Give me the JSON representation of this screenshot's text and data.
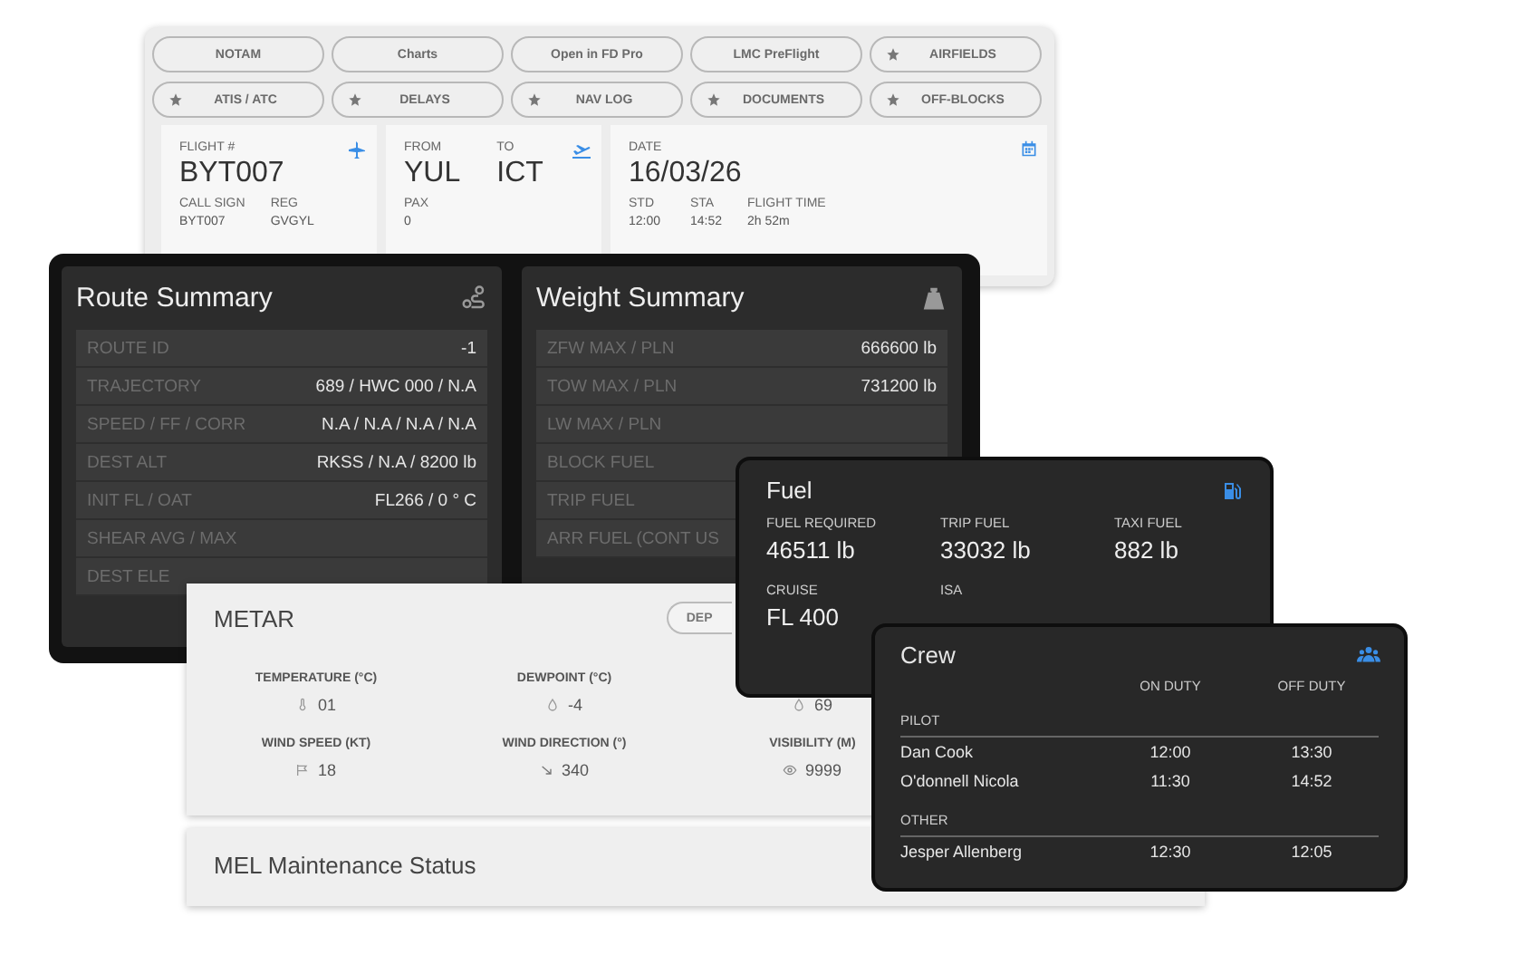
{
  "quick_buttons": [
    {
      "label": "NOTAM",
      "starred": false
    },
    {
      "label": "Charts",
      "starred": false
    },
    {
      "label": "Open in FD Pro",
      "starred": false
    },
    {
      "label": "LMC PreFlight",
      "starred": false
    },
    {
      "label": "AIRFIELDS",
      "starred": true
    },
    {
      "label": "ATIS / ATC",
      "starred": true
    },
    {
      "label": "DELAYS",
      "starred": true
    },
    {
      "label": "NAV LOG",
      "starred": true
    },
    {
      "label": "DOCUMENTS",
      "starred": true
    },
    {
      "label": "OFF-BLOCKS",
      "starred": true
    }
  ],
  "flight_cards": [
    {
      "kind": "flight",
      "heads": [
        {
          "label": "FLIGHT #",
          "value": "BYT007"
        }
      ],
      "fields": [
        {
          "label": "CALL SIGN",
          "value": "BYT007"
        },
        {
          "label": "REG",
          "value": "GVGYL"
        }
      ]
    },
    {
      "kind": "route",
      "heads": [
        {
          "label": "FROM",
          "value": "YUL"
        },
        {
          "label": "TO",
          "value": "ICT"
        }
      ],
      "fields": [
        {
          "label": "PAX",
          "value": "0"
        }
      ]
    },
    {
      "kind": "date",
      "heads": [
        {
          "label": "DATE",
          "value": "16/03/26"
        }
      ],
      "fields": [
        {
          "label": "STD",
          "value": "12:00"
        },
        {
          "label": "STA",
          "value": "14:52"
        },
        {
          "label": "FLIGHT TIME",
          "value": "2h 52m"
        }
      ]
    }
  ],
  "summaries": [
    {
      "title": "Route Summary",
      "kind": "route",
      "rows": [
        {
          "label": "ROUTE ID",
          "value": "-1"
        },
        {
          "label": "TRAJECTORY",
          "value": "689 / HWC 000 / N.A"
        },
        {
          "label": "SPEED / FF / CORR",
          "value": "N.A / N.A / N.A / N.A"
        },
        {
          "label": "DEST ALT",
          "value": "RKSS / N.A / 8200 lb"
        },
        {
          "label": "INIT FL / OAT",
          "value": "FL266 / 0 ° C"
        },
        {
          "label": "SHEAR AVG / MAX"
        },
        {
          "label": "DEST ELE"
        }
      ]
    },
    {
      "title": "Weight Summary",
      "kind": "weight",
      "rows": [
        {
          "label": "ZFW MAX / PLN",
          "value": "666600 lb"
        },
        {
          "label": "TOW MAX / PLN",
          "value": "731200 lb"
        },
        {
          "label": "LW MAX / PLN"
        },
        {
          "label": "BLOCK FUEL"
        },
        {
          "label": "TRIP FUEL"
        },
        {
          "label": "ARR FUEL (CONT US"
        }
      ]
    }
  ],
  "metar": {
    "title": "METAR",
    "toggle": "DEP",
    "items": [
      {
        "label": "TEMPERATURE (°C)",
        "value": "01",
        "kind": "temperature"
      },
      {
        "label": "DEWPOINT (°C)",
        "value": "-4",
        "kind": "drop"
      },
      {
        "value": "69",
        "kind": "humidity"
      },
      {
        "label": "WIND SPEED (KT)",
        "value": "18",
        "kind": "wind"
      },
      {
        "label": "WIND DIRECTION (°)",
        "value": "340",
        "kind": "direction"
      },
      {
        "label": "VISIBILITY (M)",
        "value": "9999",
        "kind": "eye"
      }
    ]
  },
  "mel": {
    "title": "MEL Maintenance Status"
  },
  "fuel": {
    "title": "Fuel",
    "items": [
      {
        "label": "FUEL REQUIRED",
        "value": "46511 lb"
      },
      {
        "label": "TRIP FUEL",
        "value": "33032 lb"
      },
      {
        "label": "TAXI FUEL",
        "value": "882 lb"
      },
      {
        "label": "CRUISE",
        "value": "FL 400"
      },
      {
        "label": "ISA"
      }
    ]
  },
  "crew": {
    "title": "Crew",
    "columns": [
      "ON DUTY",
      "OFF DUTY"
    ],
    "groups": [
      {
        "name": "PILOT",
        "members": [
          {
            "name": "Dan Cook",
            "on": "12:00",
            "off": "13:30"
          },
          {
            "name": "O'donnell Nicola",
            "on": "11:30",
            "off": "14:52"
          }
        ]
      },
      {
        "name": "OTHER",
        "members": [
          {
            "name": "Jesper Allenberg",
            "on": "12:30",
            "off": "12:05"
          }
        ]
      }
    ]
  }
}
